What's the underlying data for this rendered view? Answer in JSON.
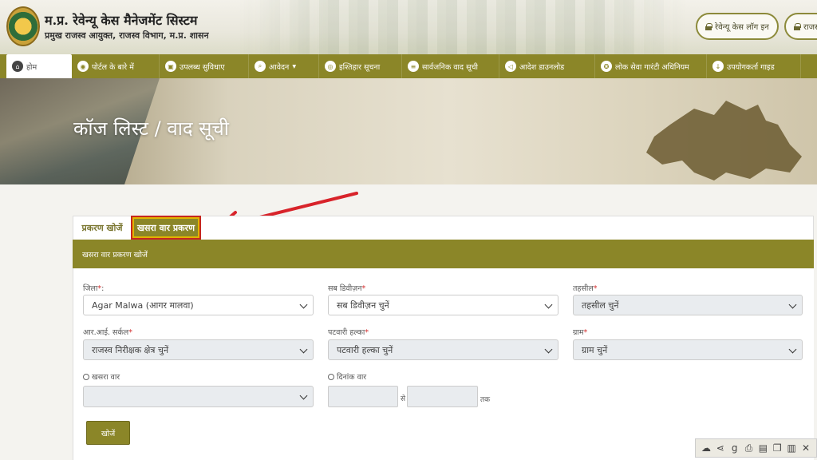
{
  "header": {
    "title": "म.प्र. रेवेन्यू केस मैनेजमेंट सिस्टम",
    "subtitle": "प्रमुख राजस्व आयुक्त, राजस्व विभाग, म.प्र. शासन",
    "login_revenue": "रेवेन्यू केस लॉग इन",
    "login_second": "राजस्"
  },
  "nav": {
    "items": [
      {
        "label": "होम",
        "icon": "home-icon"
      },
      {
        "label": "पोर्टल के बारे में",
        "icon": "eye-icon"
      },
      {
        "label": "उपलब्ध सुविधाए",
        "icon": "briefcase-icon"
      },
      {
        "label": "आवेदन",
        "icon": "search-icon",
        "dropdown": true
      },
      {
        "label": "इश्तिहार सूचना",
        "icon": "notice-icon"
      },
      {
        "label": "सार्वजनिक वाद सूची",
        "icon": "list-icon"
      },
      {
        "label": "आदेश डाउनलोड",
        "icon": "megaphone-icon"
      },
      {
        "label": "लोक सेवा गारंटी अधिनियम",
        "icon": "guarantee-icon"
      },
      {
        "label": "उपयोगकर्ता गाइड",
        "icon": "download-icon"
      }
    ]
  },
  "banner": {
    "title": "कॉज लिस्ट / वाद सूची"
  },
  "tabs": {
    "search_case": "प्रकरण खोजें",
    "khasra_case": "खसरा वार प्रकरण"
  },
  "panel": {
    "heading": "खसरा वार प्रकरण खोजें"
  },
  "form": {
    "district": {
      "label": "जिला",
      "value": "Agar Malwa (आगर मालवा)"
    },
    "subdivision": {
      "label": "सब डिवीज़न",
      "value": "सब डिवीज़न चुनें"
    },
    "tehsil": {
      "label": "तहसील",
      "value": "तहसील चुनें"
    },
    "ri_circle": {
      "label": "आर.आई. सर्कल",
      "value": "राजस्व निरीक्षक क्षेत्र चुनें"
    },
    "patwari": {
      "label": "पटवारी हल्का",
      "value": "पटवारी हल्का चुनें"
    },
    "village": {
      "label": "ग्राम",
      "value": "ग्राम चुनें"
    },
    "khasra_radio": "खसरा वार",
    "date_radio": "दिनांक वार",
    "from_word": "से",
    "to_word": "तक",
    "search_button": "खोजें"
  },
  "colors": {
    "nav": "#8b8628",
    "highlight": "#c5261f",
    "tab_border": "#e0b400"
  }
}
